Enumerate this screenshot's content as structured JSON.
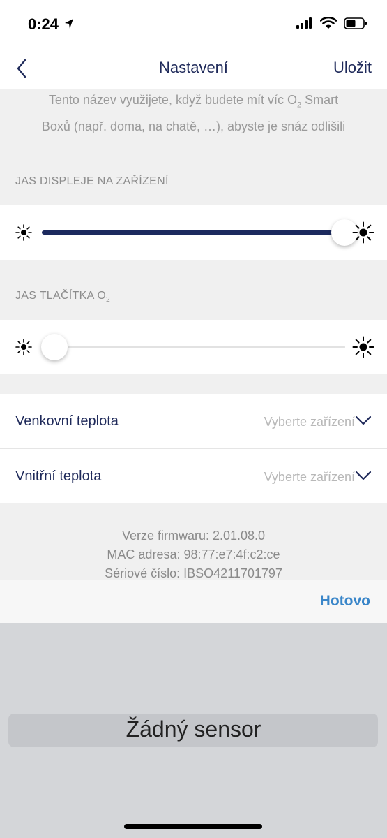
{
  "status_bar": {
    "time": "0:24"
  },
  "nav": {
    "title": "Nastavení",
    "save_label": "Uložit"
  },
  "description": {
    "line1_before": "Tento název využijete, když budete mít víc O",
    "line1_sub": "2",
    "line1_after": " Smart",
    "line2": "Boxů (např. doma, na chatě, …), abyste je snáz odlišili"
  },
  "display_brightness": {
    "label": "JAS DISPLEJE NA ZAŘÍZENÍ",
    "value_fraction": 1.0
  },
  "button_brightness": {
    "label": "JAS TLAČÍTKA O",
    "label_sub": "2",
    "value_fraction": 0.0
  },
  "outdoor_temp": {
    "label": "Venkovní teplota",
    "placeholder": "Vyberte zařízení"
  },
  "indoor_temp": {
    "label": "Vnitřní teplota",
    "placeholder": "Vyberte zařízení"
  },
  "info": {
    "firmware": "Verze firmwaru: 2.01.08.0",
    "mac": "MAC adresa: 98:77:e7:4f:c2:ce",
    "serial": "Sériové číslo: IBSO4211701797"
  },
  "toolbar": {
    "done_label": "Hotovo"
  },
  "picker": {
    "selected_option": "Žádný sensor"
  },
  "colors": {
    "navy": "#1f2a5a",
    "accent_blue": "#3a86c9",
    "slider_fill": "#1c2a5e"
  }
}
